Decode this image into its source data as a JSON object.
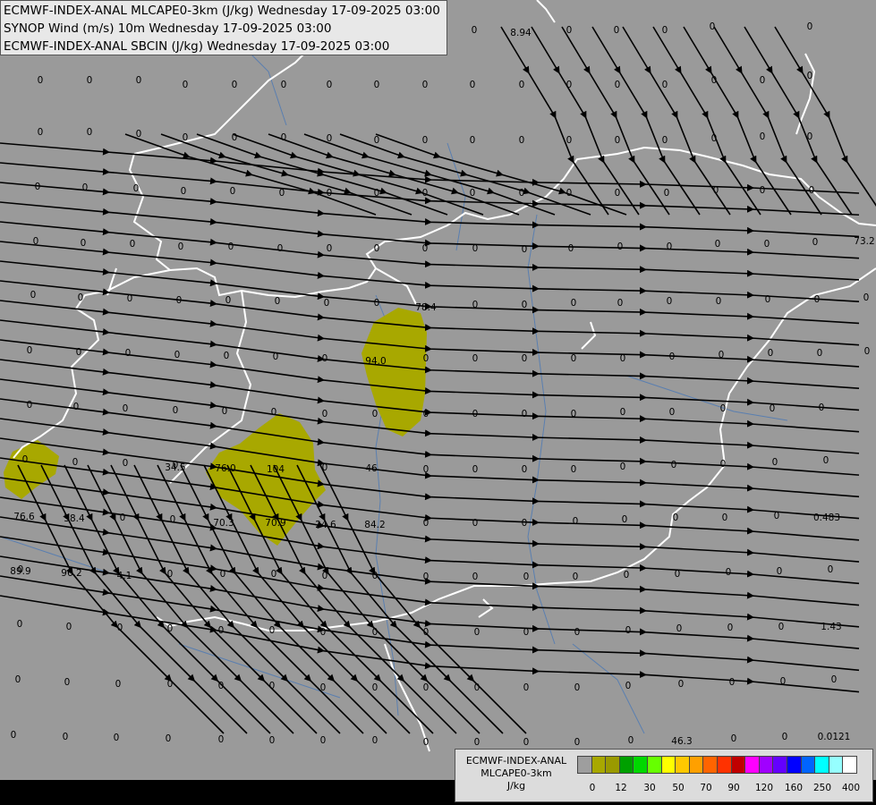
{
  "header": {
    "line1": "ECMWF-INDEX-ANAL MLCAPE0-3km (J/kg) Wednesday 17-09-2025 03:00",
    "line2": "SYNOP Wind (m/s) 10m Wednesday 17-09-2025 03:00",
    "line3": "ECMWF-INDEX-ANAL SBCIN (J/kg) Wednesday 17-09-2025 03:00"
  },
  "legend": {
    "title_line1": "ECMWF-INDEX-ANAL",
    "title_line2": "MLCAPE0-3km",
    "title_line3": "J/kg",
    "colors": [
      "#9e9e9e",
      "#a8a800",
      "#9a9a00",
      "#00a000",
      "#00d800",
      "#66ff00",
      "#ffff00",
      "#ffc800",
      "#ffa000",
      "#ff6400",
      "#ff3200",
      "#c00000",
      "#ff00ff",
      "#a000ff",
      "#6400ff",
      "#0000ff",
      "#0064ff",
      "#00ffff",
      "#96ffff",
      "#ffffff"
    ],
    "ticks": [
      "0",
      "12",
      "30",
      "50",
      "70",
      "90",
      "120",
      "160",
      "250",
      "400"
    ]
  },
  "map": {
    "cape_fill_color": "#a8a800",
    "border_color": "#ffffff",
    "river_color": "#5a7fb0",
    "streamline_color": "#000000",
    "cape_values": [
      {
        "label": "8.94"
      },
      {
        "label": "78.4"
      },
      {
        "label": "94.0"
      },
      {
        "label": "104"
      },
      {
        "label": "76.0"
      },
      {
        "label": "34.5"
      },
      {
        "label": "70.3"
      },
      {
        "label": "70.9"
      },
      {
        "label": "24.6"
      },
      {
        "label": "84.2"
      },
      {
        "label": "76.6"
      },
      {
        "label": "38.4"
      },
      {
        "label": "89.9"
      },
      {
        "label": "96.2"
      },
      {
        "label": "4.1"
      },
      {
        "label": "0.483"
      },
      {
        "label": "1.43"
      },
      {
        "label": "46.3"
      },
      {
        "label": "0.0121"
      },
      {
        "label": "73.2"
      },
      {
        "label": "46"
      }
    ],
    "zero_label": "0"
  }
}
